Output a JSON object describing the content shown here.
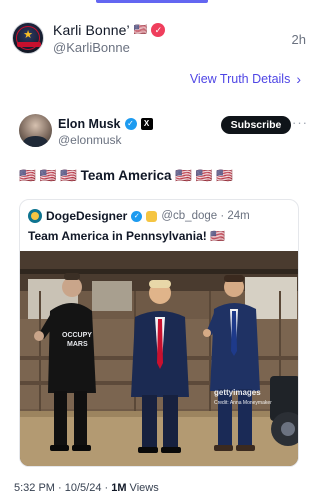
{
  "post": {
    "display_name": "Karli Bonne’",
    "flag": "🇺🇸",
    "handle": "@KarliBonne",
    "time": "2h",
    "details_link": "View Truth Details",
    "chevron": "›"
  },
  "embed": {
    "author_name": "Elon Musk",
    "author_handle": "@elonmusk",
    "subscribe_label": "Subscribe",
    "more": "···",
    "text": "🇺🇸 🇺🇸 🇺🇸 Team America 🇺🇸 🇺🇸 🇺🇸",
    "quote": {
      "author_name": "DogeDesigner",
      "handle_time": "@cb_doge · 24m",
      "text": "Team America in Pennsylvania! 🇺🇸",
      "photo_watermark": "gettyimages",
      "photo_credit": "Credit: Anna Moneymaker"
    }
  },
  "footer": {
    "datetime": "5:32 PM · 10/5/24 · ",
    "views_count": "1M",
    "views_label": " Views"
  },
  "colors": {
    "accent": "#4f46e5",
    "verified_red": "#ef3e5c",
    "x_verified_blue": "#1d9bf0"
  },
  "icons": [
    "verified-badge-icon",
    "chevron-right-icon",
    "x-logo-icon",
    "more-icon"
  ]
}
